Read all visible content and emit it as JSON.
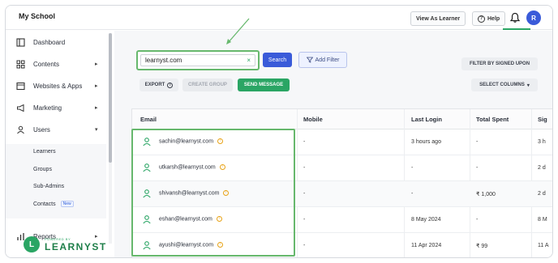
{
  "header": {
    "brand": "My School",
    "view_as_learner": "View As Learner",
    "help": "Help",
    "avatar_initial": "R"
  },
  "sidebar": {
    "items": [
      {
        "label": "Dashboard"
      },
      {
        "label": "Contents"
      },
      {
        "label": "Websites & Apps"
      },
      {
        "label": "Marketing"
      },
      {
        "label": "Users"
      },
      {
        "label": "Reports"
      }
    ],
    "sub_items": [
      {
        "label": "Learners"
      },
      {
        "label": "Groups"
      },
      {
        "label": "Sub-Admins"
      },
      {
        "label": "Contacts"
      }
    ],
    "new_badge": "New",
    "powered_by": "POWERED BY",
    "powered_name": "LEARNYST"
  },
  "toolbar": {
    "search_value": "learnyst.com",
    "search_button": "Search",
    "add_filter": "Add Filter",
    "filter_signed_upon": "FILTER BY SIGNED UPON",
    "export": "EXPORT",
    "create_group": "CREATE GROUP",
    "send_message": "SEND MESSAGE",
    "select_columns": "SELECT COLUMNS"
  },
  "table": {
    "headers": [
      "Email",
      "Mobile",
      "Last Login",
      "Total Spent",
      "Sig"
    ],
    "rows": [
      {
        "email": "sachin@learnyst.com",
        "mobile": "-",
        "last_login": "3 hours ago",
        "total_spent": "-",
        "signed": "3 h"
      },
      {
        "email": "utkarsh@learnyst.com",
        "mobile": "-",
        "last_login": "-",
        "total_spent": "-",
        "signed": "2 d"
      },
      {
        "email": "shivansh@learnyst.com",
        "mobile": "-",
        "last_login": "-",
        "total_spent": "₹ 1,000",
        "signed": "2 d"
      },
      {
        "email": "eshan@learnyst.com",
        "mobile": "-",
        "last_login": "8 May 2024",
        "total_spent": "-",
        "signed": "8 M"
      },
      {
        "email": "ayushi@learnyst.com",
        "mobile": "-",
        "last_login": "11 Apr 2024",
        "total_spent": "₹ 99",
        "signed": "11 A"
      }
    ]
  },
  "colors": {
    "accent_green": "#2aa564",
    "highlight_green": "#67b86d",
    "primary_blue": "#3a5bd9"
  }
}
